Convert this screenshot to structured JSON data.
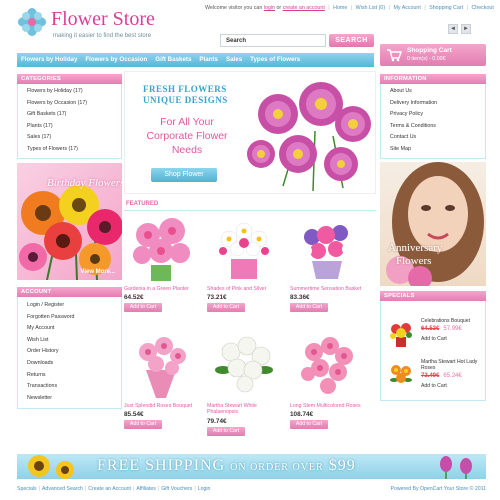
{
  "header": {
    "store_name": "Flower Store",
    "tagline": "making it easier to find the best store",
    "welcome_text": "Welcome visitor you can",
    "login": "login",
    "or": "or",
    "create_account": "create an account",
    "links": [
      "Home",
      "Wish List (0)",
      "My Account",
      "Shopping Cart",
      "Checkout"
    ]
  },
  "search": {
    "value": "Search",
    "button": "SEARCH"
  },
  "page_arrows": {
    "prev": "◄",
    "next": "►"
  },
  "cart": {
    "title": "Shopping Cart",
    "summary": "0 item(s) - 0.00€"
  },
  "nav": [
    "Flowers by Holiday",
    "Flowers by Occasion",
    "Gift Baskets",
    "Plants",
    "Sales",
    "Types of Flowers"
  ],
  "categories": {
    "title": "CATEGORIES",
    "items": [
      "Flowers by Holiday (17)",
      "Flowers by Occasion (17)",
      "Gift Baskets (17)",
      "Plants (17)",
      "Sales (17)",
      "Types of Flowers (17)"
    ]
  },
  "information": {
    "title": "INFORMATION",
    "items": [
      "About Us",
      "Delivery Information",
      "Privacy Policy",
      "Terms & Conditions",
      "Contact Us",
      "Site Map"
    ]
  },
  "hero": {
    "line1": "FRESH FLOWERS",
    "line2": "UNIQUE DESIGNS",
    "line3": "For All Your Corporate Flower Needs",
    "button": "Shop Flower"
  },
  "birthday_banner": {
    "title": "Birthday Flowers",
    "link": "View More..."
  },
  "anniversary_banner": {
    "line1": "Anniversary",
    "line2": "Flowers"
  },
  "featured": {
    "title": "FEATURED",
    "products": [
      {
        "name": "Gardenia in a Green Planter",
        "price": "64.52€",
        "add": "Add to Cart"
      },
      {
        "name": "Shades of Pink and Silver",
        "price": "73.21€",
        "add": "Add to Cart"
      },
      {
        "name": "Summertime Sensation Basket",
        "price": "83.36€",
        "add": "Add to Cart"
      },
      {
        "name": "Just Splendid Roses Bouquet",
        "price": "85.54€",
        "add": "Add to Cart"
      },
      {
        "name": "Martha Stewart White Phalaenopsis",
        "price": "79.74€",
        "add": "Add to Cart"
      },
      {
        "name": "Long Stem Multicolored Roses",
        "price": "108.74€",
        "add": "Add to Cart"
      }
    ]
  },
  "account": {
    "title": "ACCOUNT",
    "items": [
      "Login / Register",
      "Forgotten Password",
      "My Account",
      "Wish List",
      "Order History",
      "Downloads",
      "Returns",
      "Transactions",
      "Newsletter"
    ]
  },
  "specials": {
    "title": "SPECIALS",
    "items": [
      {
        "name": "Celebrations Bouquet",
        "old_price": "64.52€",
        "new_price": "57.99€",
        "add": "Add to Cart"
      },
      {
        "name": "Martha Stewart Hot Lady Roses",
        "old_price": "72.49€",
        "new_price": "65.24€",
        "add": "Add to Cart"
      }
    ]
  },
  "shipping_banner": {
    "main": "FREE SHIPPING",
    "small": "ON ORDER OVER",
    "amount": "$99"
  },
  "footer": {
    "links": [
      "Specials",
      "Advanced Search",
      "Create an Account",
      "Affiliates",
      "Gift Vouchers",
      "Login"
    ],
    "powered": "Powered By OpenCart Your Store © 2011"
  },
  "colors": {
    "pink": "#e47db3",
    "blue": "#57b6d8",
    "brand": "#dc3e97"
  }
}
